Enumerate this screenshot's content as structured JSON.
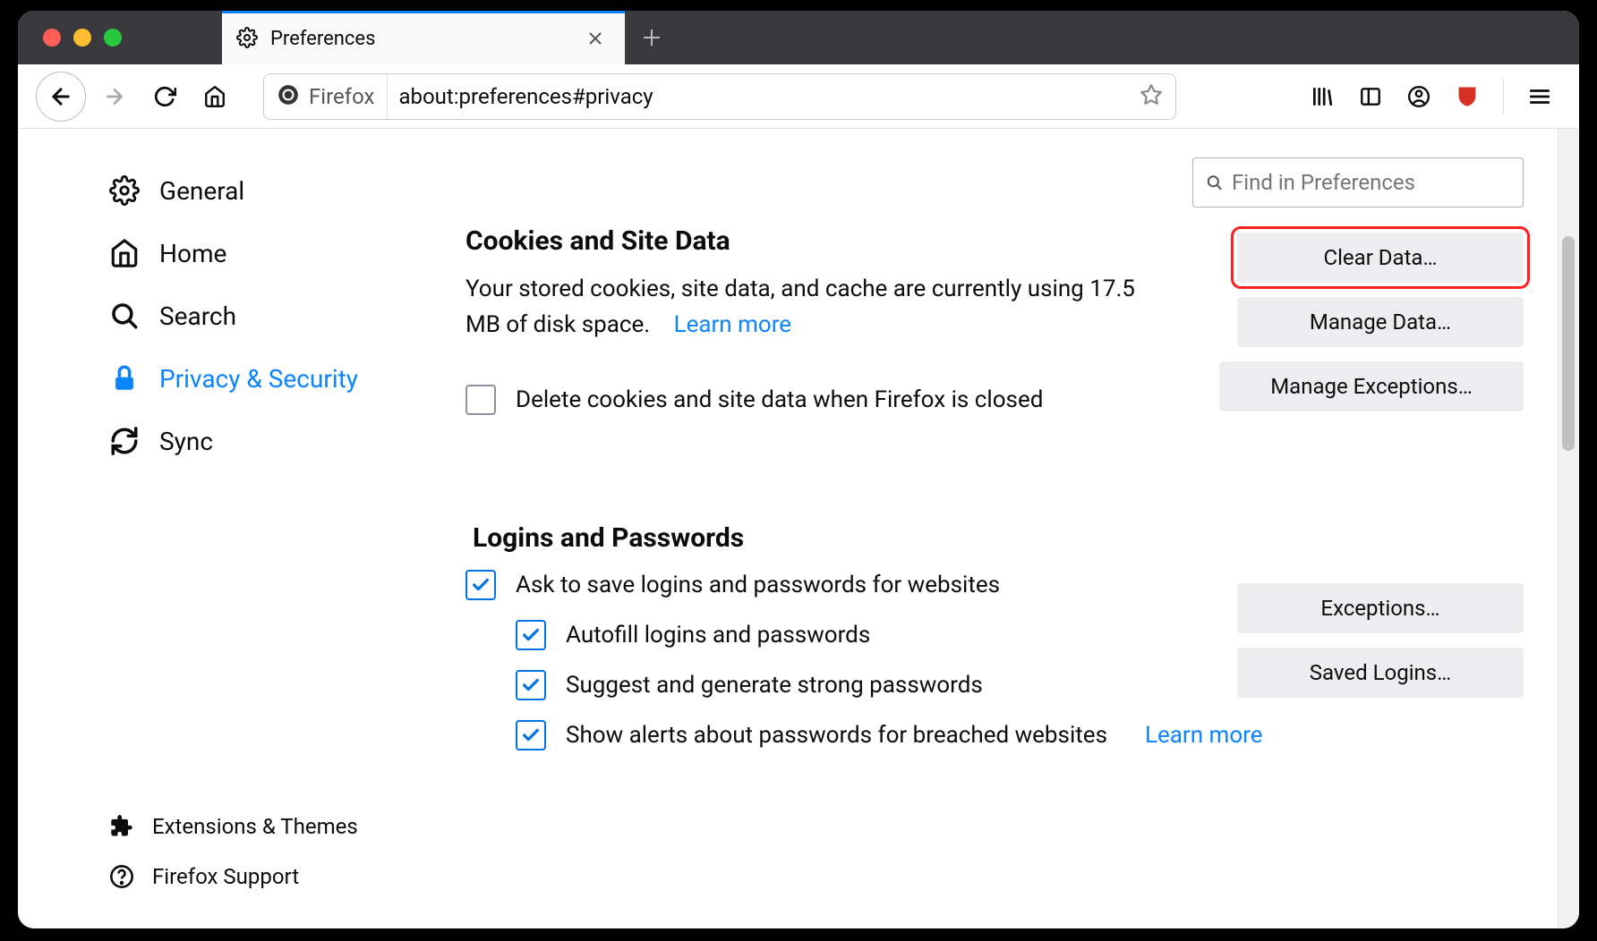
{
  "tab": {
    "title": "Preferences"
  },
  "urlbar": {
    "identity": "Firefox",
    "url": "about:preferences#privacy"
  },
  "search": {
    "placeholder": "Find in Preferences"
  },
  "sidebar": {
    "items": [
      {
        "label": "General"
      },
      {
        "label": "Home"
      },
      {
        "label": "Search"
      },
      {
        "label": "Privacy & Security"
      },
      {
        "label": "Sync"
      }
    ],
    "footer": [
      {
        "label": "Extensions & Themes"
      },
      {
        "label": "Firefox Support"
      }
    ]
  },
  "cookies": {
    "heading": "Cookies and Site Data",
    "desc": "Your stored cookies, site data, and cache are currently using 17.5 MB of disk space.",
    "learn_more": "Learn more",
    "delete_on_close": "Delete cookies and site data when Firefox is closed",
    "btn_clear": "Clear Data…",
    "btn_manage": "Manage Data…",
    "btn_exceptions": "Manage Exceptions…"
  },
  "logins": {
    "heading": "Logins and Passwords",
    "ask_save": "Ask to save logins and passwords for websites",
    "autofill": "Autofill logins and passwords",
    "suggest": "Suggest and generate strong passwords",
    "breach": "Show alerts about passwords for breached websites",
    "learn_more": "Learn more",
    "btn_exceptions": "Exceptions…",
    "btn_saved": "Saved Logins…"
  }
}
